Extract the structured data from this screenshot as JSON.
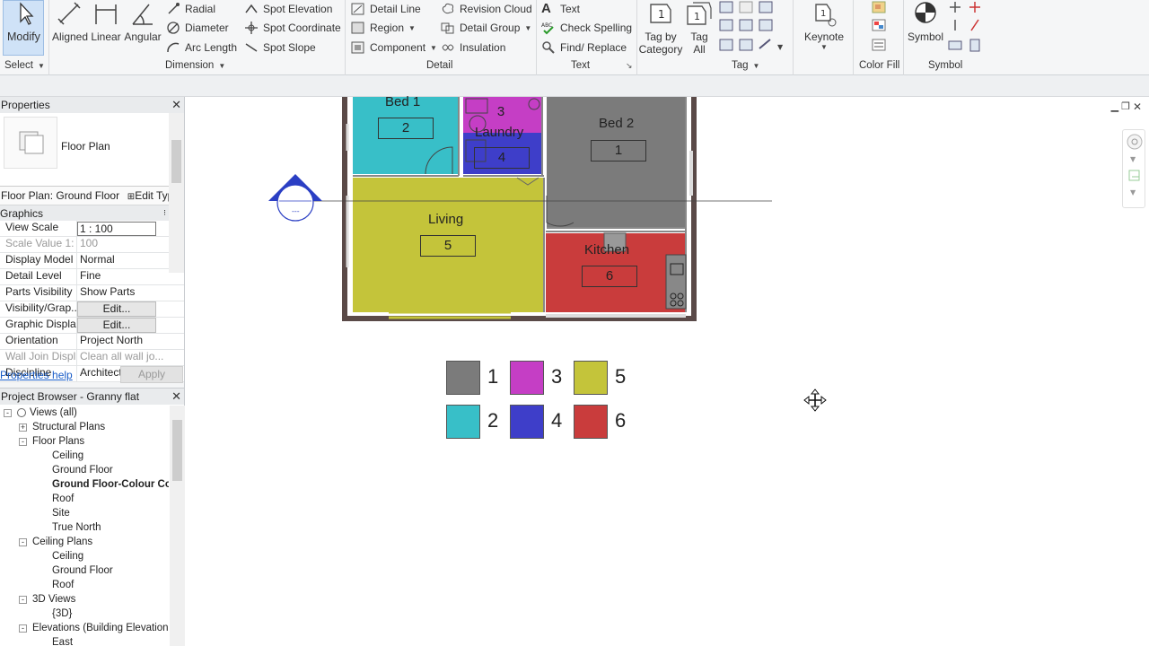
{
  "ribbon": {
    "modify_label": "Modify",
    "select_label": "Select",
    "dimension": {
      "aligned": "Aligned",
      "linear": "Linear",
      "angular": "Angular",
      "radial": "Radial",
      "diameter": "Diameter",
      "arc_length": "Arc  Length",
      "spot_elevation": "Spot  Elevation",
      "spot_coordinate": "Spot  Coordinate",
      "spot_slope": "Spot  Slope",
      "group_label": "Dimension"
    },
    "detail": {
      "detail_line": "Detail  Line",
      "region": "Region",
      "component": "Component",
      "revision_cloud": "Revision  Cloud",
      "detail_group": "Detail  Group",
      "insulation": "Insulation",
      "group_label": "Detail"
    },
    "text": {
      "text": "Text",
      "check_spelling": "Check  Spelling",
      "find_replace": "Find/  Replace",
      "group_label": "Text"
    },
    "tag": {
      "tag_by_category_l1": "Tag by",
      "tag_by_category_l2": "Category",
      "tag_all_l1": "Tag",
      "tag_all_l2": "All",
      "group_label": "Tag"
    },
    "keynote_label": "Keynote",
    "color_fill_label": "Color Fill",
    "symbol_label": "Symbol",
    "symbol_group_label": "Symbol"
  },
  "properties": {
    "title": "Properties",
    "type_name": "Floor Plan",
    "instance_selector": "Floor Plan: Ground Floor",
    "edit_type": "Edit Type",
    "category": "Graphics",
    "rows": [
      {
        "name": "View Scale",
        "value": "1 : 100"
      },
      {
        "name": "Scale Value    1:",
        "value": "100"
      },
      {
        "name": "Display Model",
        "value": "Normal"
      },
      {
        "name": "Detail Level",
        "value": "Fine"
      },
      {
        "name": "Parts Visibility",
        "value": "Show Parts"
      },
      {
        "name": "Visibility/Grap...",
        "value": "Edit..."
      },
      {
        "name": "Graphic Displa...",
        "value": "Edit..."
      },
      {
        "name": "Orientation",
        "value": "Project North"
      },
      {
        "name": "Wall Join Displ...",
        "value": "Clean all wall jo..."
      },
      {
        "name": "Discipline",
        "value": "Architectural"
      }
    ],
    "help_link": "Properties help",
    "apply": "Apply"
  },
  "browser": {
    "title": "Project Browser - Granny flat",
    "nodes": [
      {
        "label": "Views (all)",
        "level": 0,
        "toggle": "-"
      },
      {
        "label": "Structural Plans",
        "level": 1,
        "toggle": "+"
      },
      {
        "label": "Floor Plans",
        "level": 1,
        "toggle": "-"
      },
      {
        "label": "Ceiling",
        "level": 2
      },
      {
        "label": "Ground Floor",
        "level": 2
      },
      {
        "label": "Ground Floor-Colour Co",
        "level": 2,
        "bold": true
      },
      {
        "label": "Roof",
        "level": 2
      },
      {
        "label": "Site",
        "level": 2
      },
      {
        "label": "True North",
        "level": 2
      },
      {
        "label": "Ceiling Plans",
        "level": 1,
        "toggle": "-"
      },
      {
        "label": "Ceiling",
        "level": 2
      },
      {
        "label": "Ground Floor",
        "level": 2
      },
      {
        "label": "Roof",
        "level": 2
      },
      {
        "label": "3D Views",
        "level": 1,
        "toggle": "-"
      },
      {
        "label": "{3D}",
        "level": 2
      },
      {
        "label": "Elevations (Building Elevation",
        "level": 1,
        "toggle": "-"
      },
      {
        "label": "East",
        "level": 2
      }
    ]
  },
  "plan": {
    "rooms": [
      {
        "name": "Bed 1",
        "number": "2",
        "color": "#38bfc8"
      },
      {
        "name": "Laundry",
        "number": "4",
        "color": "#3e3ec9"
      },
      {
        "name": "",
        "number": "3",
        "color": "#c53ec5"
      },
      {
        "name": "Bed 2",
        "number": "1",
        "color": "#7b7b7b"
      },
      {
        "name": "Living",
        "number": "5",
        "color": "#c4c43a"
      },
      {
        "name": "Kitchen",
        "number": "6",
        "color": "#c93c3c"
      }
    ]
  },
  "legend": [
    {
      "number": "1",
      "color": "#7b7b7b"
    },
    {
      "number": "3",
      "color": "#c53ec5"
    },
    {
      "number": "5",
      "color": "#c4c43a"
    },
    {
      "number": "2",
      "color": "#38bfc8"
    },
    {
      "number": "4",
      "color": "#3e3ec9"
    },
    {
      "number": "6",
      "color": "#c93c3c"
    }
  ],
  "icons": {
    "move_cursor": "move-cursor-icon",
    "section_marker": "elevation-marker-icon"
  }
}
